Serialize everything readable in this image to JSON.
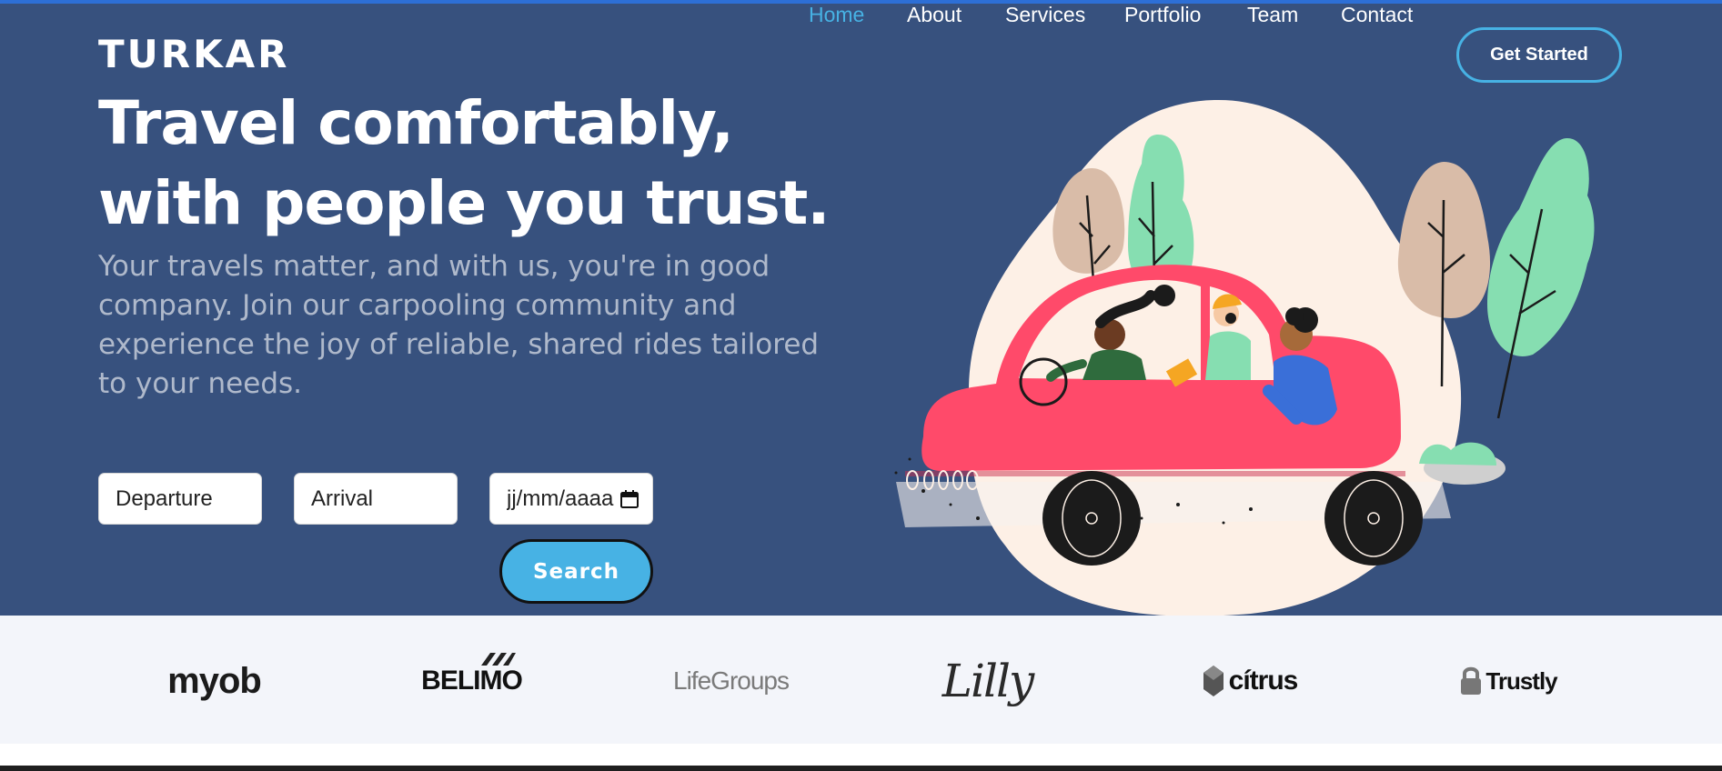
{
  "brand": {
    "name": "TURKAR"
  },
  "nav": {
    "items": [
      {
        "label": "Home",
        "active": true
      },
      {
        "label": "About",
        "active": false
      },
      {
        "label": "Services",
        "active": false
      },
      {
        "label": "Portfolio",
        "active": false
      },
      {
        "label": "Team",
        "active": false
      },
      {
        "label": "Contact",
        "active": false
      }
    ],
    "cta_label": "Get Started"
  },
  "hero": {
    "title": "Travel comfortably, with people you trust.",
    "subtitle": "Your travels matter, and with us, you're in good company. Join our carpooling community and experience the joy of reliable, shared rides tailored to your needs."
  },
  "search": {
    "departure_placeholder": "Departure",
    "arrival_placeholder": "Arrival",
    "date_value": "jj/mm/aaaa",
    "button_label": "Search"
  },
  "clients": {
    "logos": [
      "myob",
      "BELIMO",
      "LifeGroups",
      "Lilly",
      "cítrus",
      "Trustly"
    ]
  },
  "colors": {
    "hero_bg": "#37517e",
    "accent": "#47b2e4",
    "clients_bg": "#f3f5fa"
  }
}
